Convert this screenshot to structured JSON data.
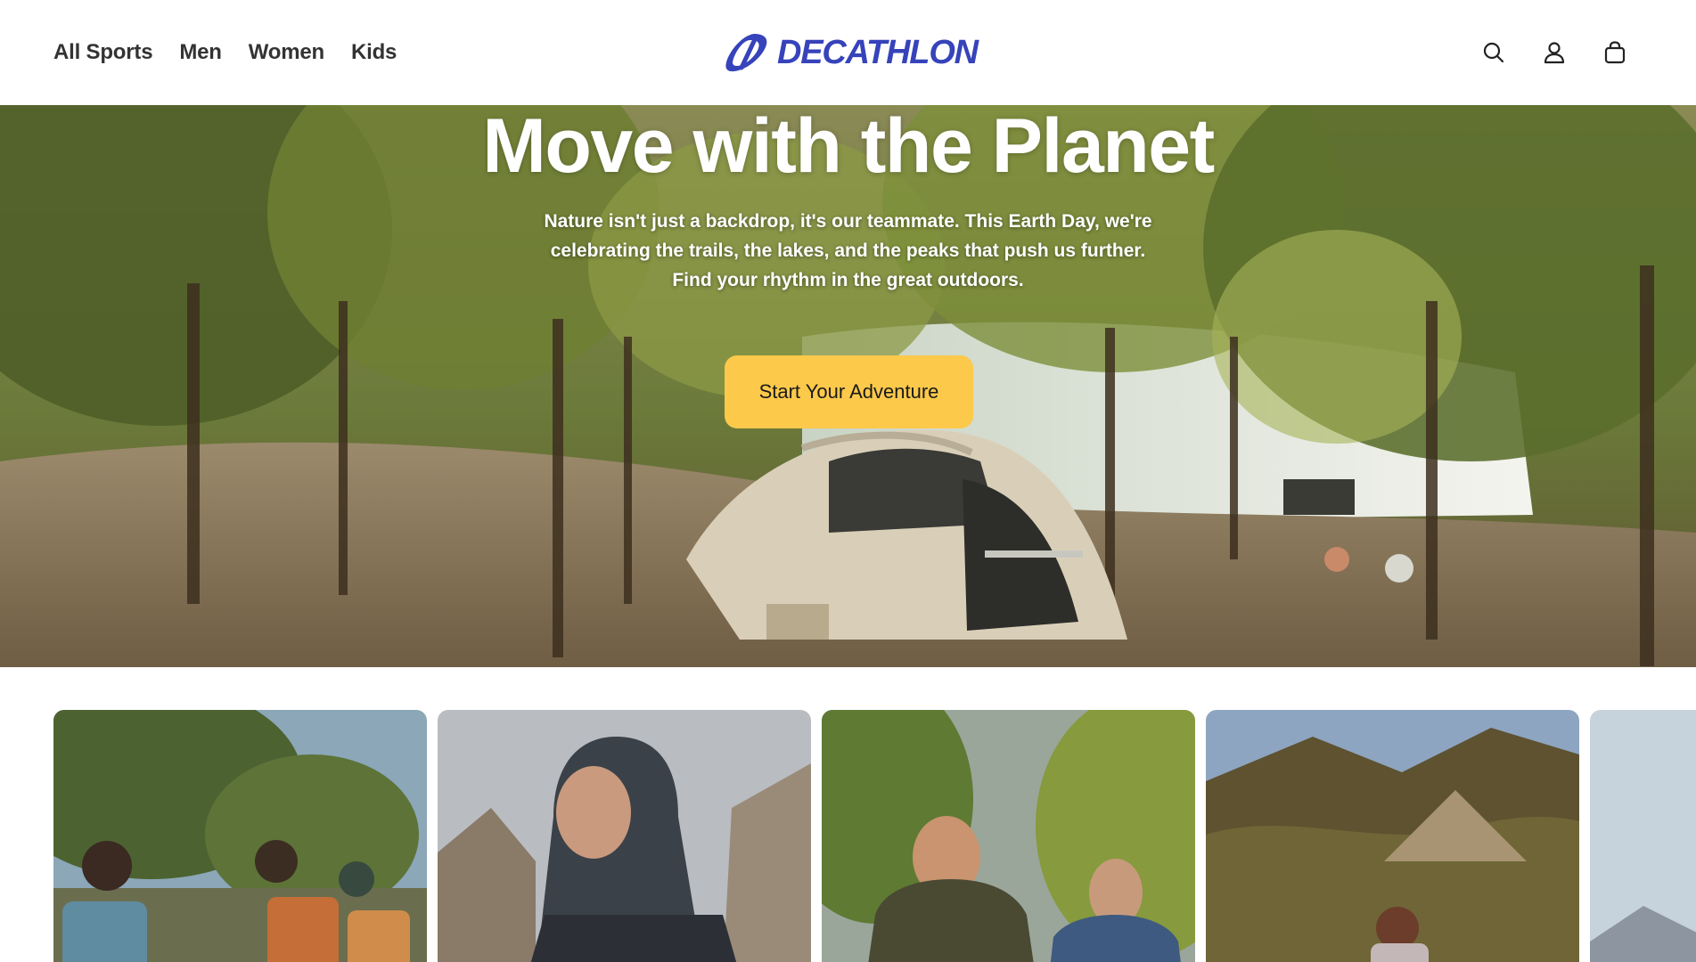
{
  "header": {
    "nav": [
      "All Sports",
      "Men",
      "Women",
      "Kids"
    ],
    "logo_text": "DECATHLON",
    "icons": [
      "search-icon",
      "account-icon",
      "cart-icon"
    ],
    "brand_color": "#3643ba"
  },
  "hero": {
    "title": "Move with the Planet",
    "subtitle": "Nature isn't just a backdrop, it's our teammate. This Earth Day, we're celebrating the trails, the lakes, and the peaks that push us further. Find your rhythm in the great outdoors.",
    "cta_label": "Start Your Adventure",
    "cta_color": "#fcc94b"
  },
  "cards": [
    {
      "image": "hikers-with-backpacks-photo"
    },
    {
      "image": "man-in-rain-jacket-photo"
    },
    {
      "image": "two-hikers-in-forest-photo"
    },
    {
      "image": "hiker-in-mountain-valley-photo"
    },
    {
      "image": "snowy-mountain-photo"
    }
  ]
}
